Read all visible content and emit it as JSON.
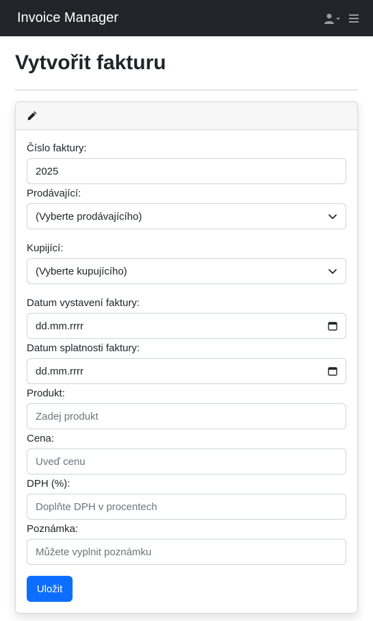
{
  "navbar": {
    "brand": "Invoice Manager",
    "user_icon": "user-icon",
    "caret_icon": "caret-down-icon",
    "menu_icon": "hamburger-icon"
  },
  "page": {
    "title": "Vytvořit fakturu"
  },
  "card": {
    "header_icon": "pencil-icon"
  },
  "form": {
    "invoice_number": {
      "label": "Číslo faktury:",
      "value": "2025"
    },
    "seller": {
      "label": "Prodávající:",
      "selected": "(Vyberte prodávajícího)"
    },
    "buyer": {
      "label": "Kupijící:",
      "selected": "(Vyberte kupujícího)"
    },
    "issue_date": {
      "label": "Datum vystavení faktury:",
      "placeholder": "dd.mm.rrrr"
    },
    "due_date": {
      "label": "Datum splatnosti faktury:",
      "placeholder": "dd.mm.rrrr"
    },
    "product": {
      "label": "Produkt:",
      "placeholder": "Zadej produkt"
    },
    "price": {
      "label": "Cena:",
      "placeholder": "Uveď cenu"
    },
    "vat": {
      "label": "DPH (%):",
      "placeholder": "Doplňte DPH v procentech"
    },
    "note": {
      "label": "Poznámka:",
      "placeholder": "Můžete vyplnit poznámku"
    },
    "save_label": "Uložit"
  },
  "colors": {
    "navbar_bg": "#212529",
    "primary": "#0d6efd"
  }
}
